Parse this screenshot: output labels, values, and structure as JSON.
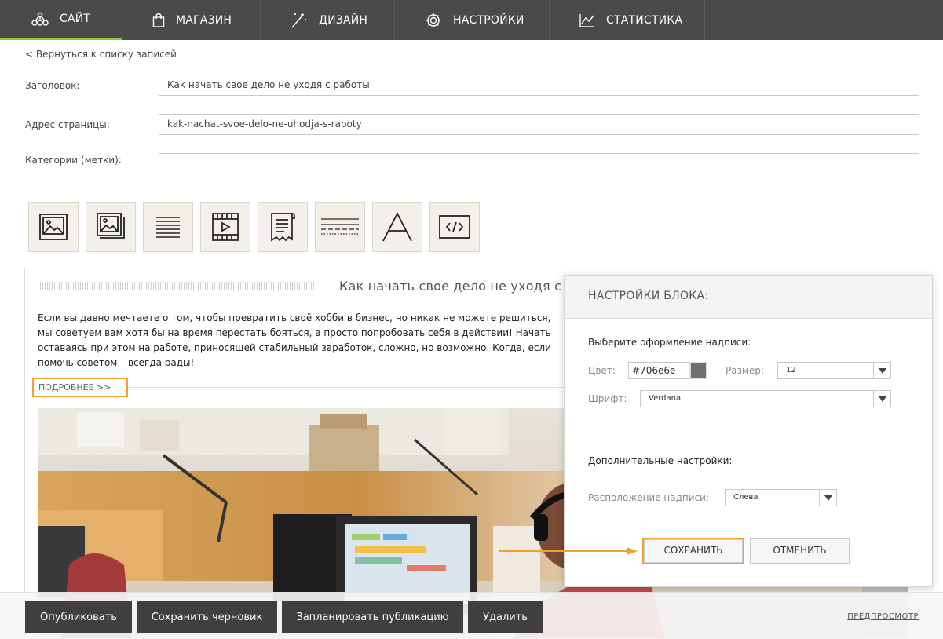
{
  "nav": {
    "items": [
      {
        "label": "САЙТ",
        "icon": "site-icon"
      },
      {
        "label": "МАГАЗИН",
        "icon": "shopping-bag-icon"
      },
      {
        "label": "ДИЗАЙН",
        "icon": "magic-wand-icon"
      },
      {
        "label": "НАСТРОЙКИ",
        "icon": "gear-icon"
      },
      {
        "label": "СТАТИСТИКА",
        "icon": "chart-icon"
      }
    ],
    "active_index": 0,
    "accent_color": "#8dc63f"
  },
  "form": {
    "back_link": "< Вернуться к списку записей",
    "title_label": "Заголовок:",
    "title_value": "Как начать свое дело не уходя с работы",
    "url_label": "Адрес страницы:",
    "url_value": "kak-nachat-svoe-delo-ne-uhodja-s-raboty",
    "categories_label": "Категории (метки):",
    "categories_value": ""
  },
  "tools": [
    {
      "icon": "image-icon"
    },
    {
      "icon": "gallery-icon"
    },
    {
      "icon": "text-lines-icon"
    },
    {
      "icon": "video-icon"
    },
    {
      "icon": "document-icon"
    },
    {
      "icon": "divider-icon"
    },
    {
      "icon": "font-icon"
    },
    {
      "icon": "code-icon"
    }
  ],
  "editor": {
    "title": "Как начать свое дело не уходя с р",
    "lines": [
      "Если вы давно мечтаете о том, чтобы превратить своё хобби в бизнес, но никак не можете решиться,",
      "мы советуем вам хотя бы на время перестать бояться, а просто попробовать себя в действии! Начать",
      "оставаясь при этом на работе, приносящей стабильный заработок, сложно, но возможно. Когда, если",
      "помочь советом – всегда рады!"
    ],
    "more_button": "ПОДРОБНЕЕ >>"
  },
  "panel": {
    "title": "НАСТРОЙКИ БЛОКА:",
    "style_heading": "Выберите оформление надписи:",
    "color_label": "Цвет:",
    "color_value": "#706e6e",
    "size_label": "Размер:",
    "size_value": "12",
    "font_label": "Шрифт:",
    "font_value": "Verdana",
    "extra_heading": "Дополнительные настройки:",
    "position_label": "Расположение надписи:",
    "position_value": "Слева",
    "save_label": "СОХРАНИТЬ",
    "cancel_label": "ОТМЕНИТЬ",
    "highlight_color": "#f0a030"
  },
  "bottom": {
    "publish": "Опубликовать",
    "save_draft": "Сохранить черновик",
    "schedule": "Запланировать публикацию",
    "delete": "Удалить",
    "preview": "ПРЕДПРОСМОТР"
  }
}
